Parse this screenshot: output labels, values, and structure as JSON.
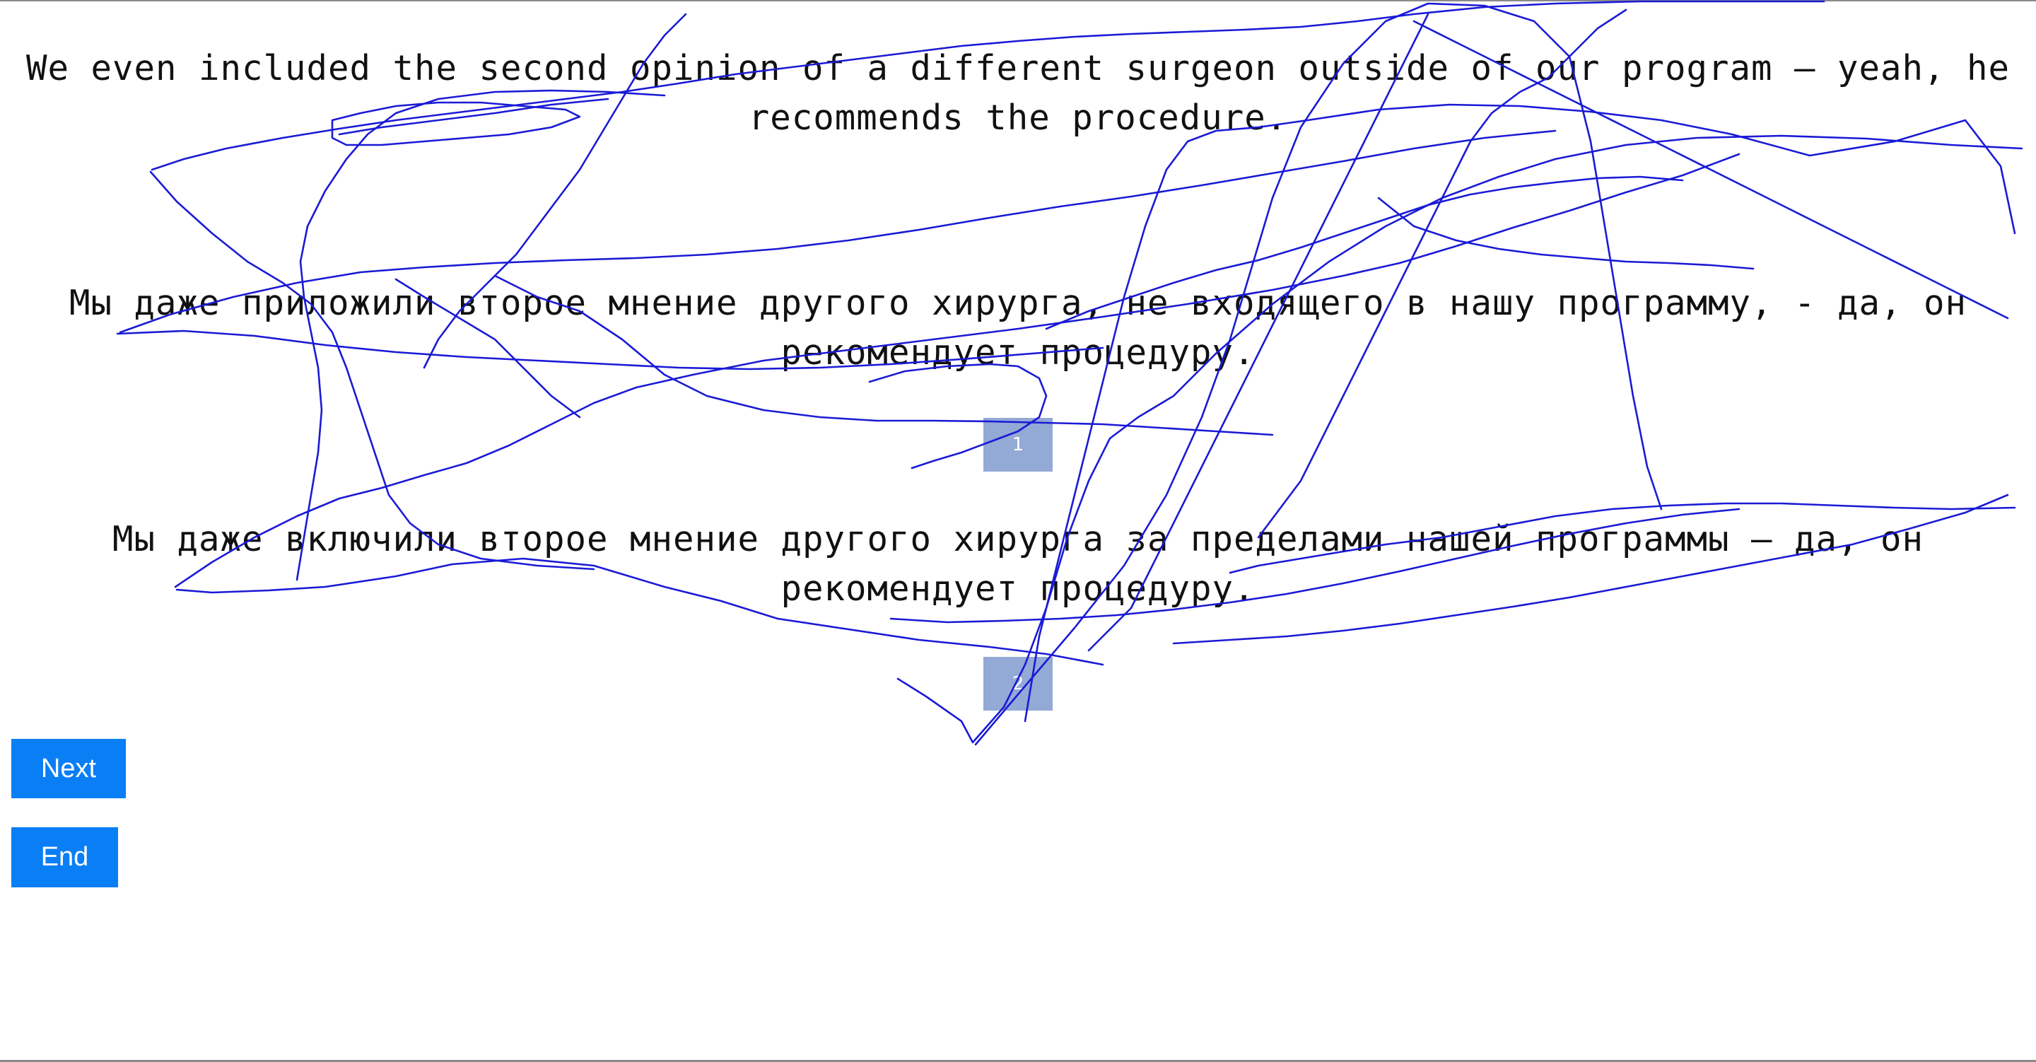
{
  "source_text": "We even included the second opinion of a different surgeon outside of our program — yeah, he recommends the procedure.",
  "translations": [
    {
      "text": "Мы даже приложили второе мнение другого хирурга, не входящего в нашу программу, - да, он рекомендует процедуру.",
      "rank": "1"
    },
    {
      "text": "Мы даже включили второе мнение другого хирурга за пределами нашей программы — да, он рекомендует процедуру.",
      "rank": "2"
    }
  ],
  "buttons": {
    "next_label": "Next",
    "end_label": "End"
  },
  "colors": {
    "button": "#0a7ef5",
    "badge": "#93a9d6",
    "scribble": "#1a1ad6"
  }
}
